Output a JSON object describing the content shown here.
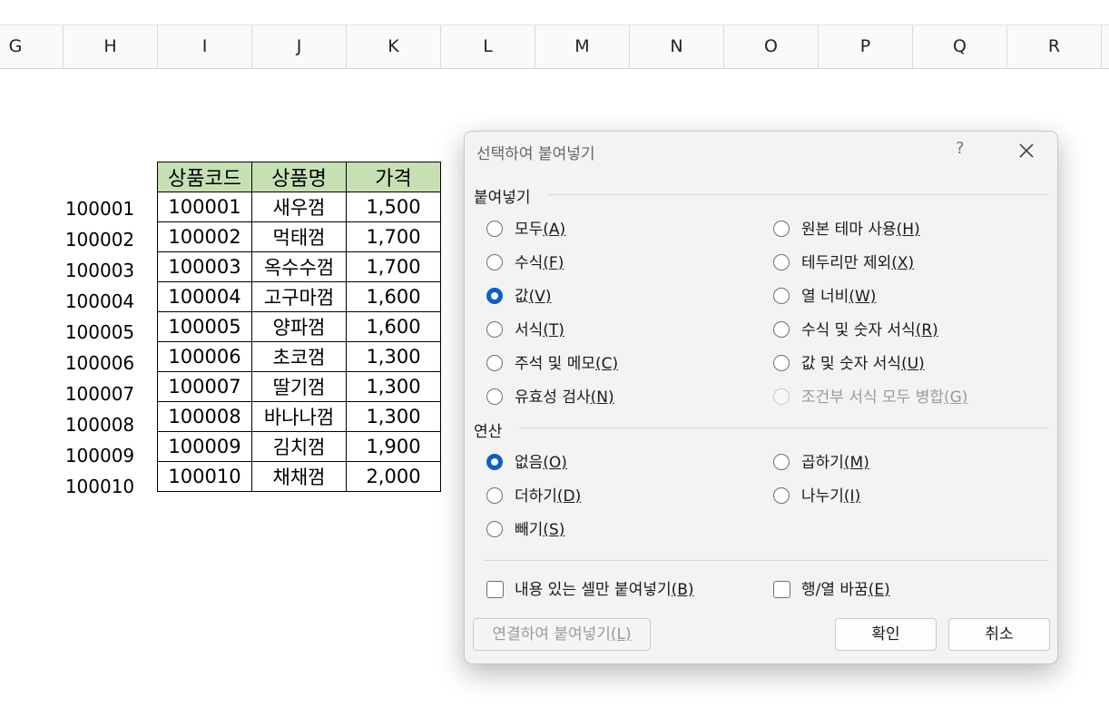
{
  "columns": [
    "G",
    "H",
    "I",
    "J",
    "K",
    "L",
    "M",
    "N",
    "O",
    "P",
    "Q",
    "R"
  ],
  "h_values": [
    "100001",
    "100002",
    "100003",
    "100004",
    "100005",
    "100006",
    "100007",
    "100008",
    "100009",
    "100010"
  ],
  "table": {
    "headers": [
      "상품코드",
      "상품명",
      "가격"
    ],
    "rows": [
      [
        "100001",
        "새우껌",
        "1,500"
      ],
      [
        "100002",
        "먹태껌",
        "1,700"
      ],
      [
        "100003",
        "옥수수껌",
        "1,700"
      ],
      [
        "100004",
        "고구마껌",
        "1,600"
      ],
      [
        "100005",
        "양파껌",
        "1,600"
      ],
      [
        "100006",
        "초코껌",
        "1,300"
      ],
      [
        "100007",
        "딸기껌",
        "1,300"
      ],
      [
        "100008",
        "바나나껌",
        "1,300"
      ],
      [
        "100009",
        "김치껌",
        "1,900"
      ],
      [
        "100010",
        "채채껌",
        "2,000"
      ]
    ],
    "header_color": "#c6e0b4"
  },
  "dialog": {
    "title": "선택하여 붙여넣기",
    "help": "?",
    "close_icon": "close-icon",
    "paste_group": "붙여넣기",
    "paste_options_left": [
      {
        "label": "모두",
        "key": "(A)",
        "checked": false
      },
      {
        "label": "수식",
        "key": "(F)",
        "checked": false
      },
      {
        "label": "값",
        "key": "(V)",
        "checked": true
      },
      {
        "label": "서식",
        "key": "(T)",
        "checked": false
      },
      {
        "label": "주석 및 메모",
        "key": "(C)",
        "checked": false
      },
      {
        "label": "유효성 검사",
        "key": "(N)",
        "checked": false
      }
    ],
    "paste_options_right": [
      {
        "label": "원본 테마 사용",
        "key": "(H)",
        "checked": false
      },
      {
        "label": "테두리만 제외",
        "key": "(X)",
        "checked": false
      },
      {
        "label": "열 너비",
        "key": "(W)",
        "checked": false
      },
      {
        "label": "수식 및 숫자 서식",
        "key": "(R)",
        "checked": false
      },
      {
        "label": "값 및 숫자 서식",
        "key": "(U)",
        "checked": false
      },
      {
        "label": "조건부 서식 모두 병합",
        "key": "(G)",
        "checked": false,
        "disabled": true
      }
    ],
    "operation_group": "연산",
    "operation_left": [
      {
        "label": "없음",
        "key": "(O)",
        "checked": true
      },
      {
        "label": "더하기",
        "key": "(D)",
        "checked": false
      },
      {
        "label": "빼기",
        "key": "(S)",
        "checked": false
      }
    ],
    "operation_right": [
      {
        "label": "곱하기",
        "key": "(M)",
        "checked": false
      },
      {
        "label": "나누기",
        "key": "(I)",
        "checked": false
      }
    ],
    "skip_blanks": {
      "label": "내용 있는 셀만 붙여넣기",
      "key": "(B)"
    },
    "transpose": {
      "label": "행/열 바꿈",
      "key": "(E)"
    },
    "paste_link": {
      "label": "연결하여 붙여넣기",
      "key": "(L)"
    },
    "ok": "확인",
    "cancel": "취소",
    "accent_color": "#0f5fc2"
  }
}
